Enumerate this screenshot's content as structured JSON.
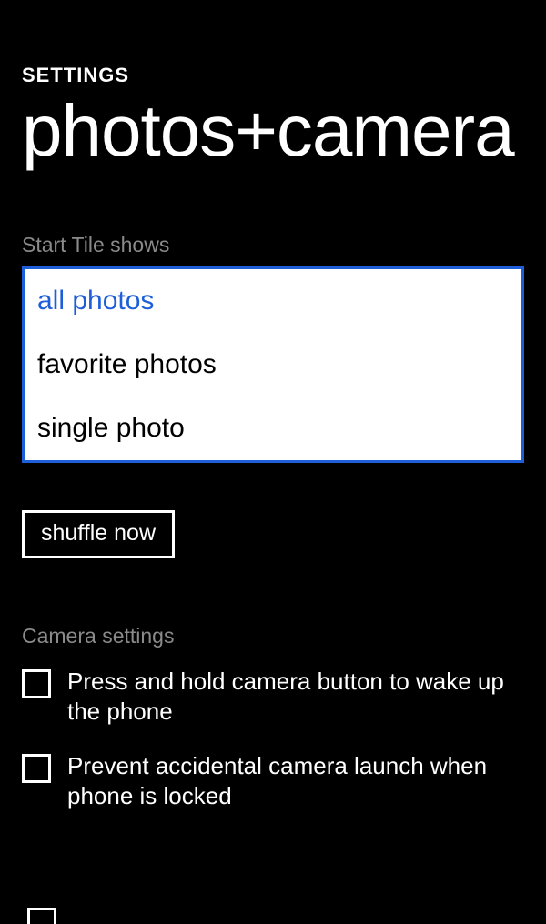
{
  "header": {
    "app_label": "SETTINGS",
    "page_title": "photos+camera"
  },
  "start_tile": {
    "label": "Start Tile shows",
    "options": {
      "opt0": "all photos",
      "opt1": "favorite photos",
      "opt2": "single photo"
    }
  },
  "actions": {
    "shuffle_label": "shuffle now"
  },
  "camera_settings": {
    "label": "Camera settings",
    "items": {
      "item0": "Press and hold camera button to wake up the phone",
      "item1": "Prevent accidental camera launch when phone is locked"
    }
  }
}
